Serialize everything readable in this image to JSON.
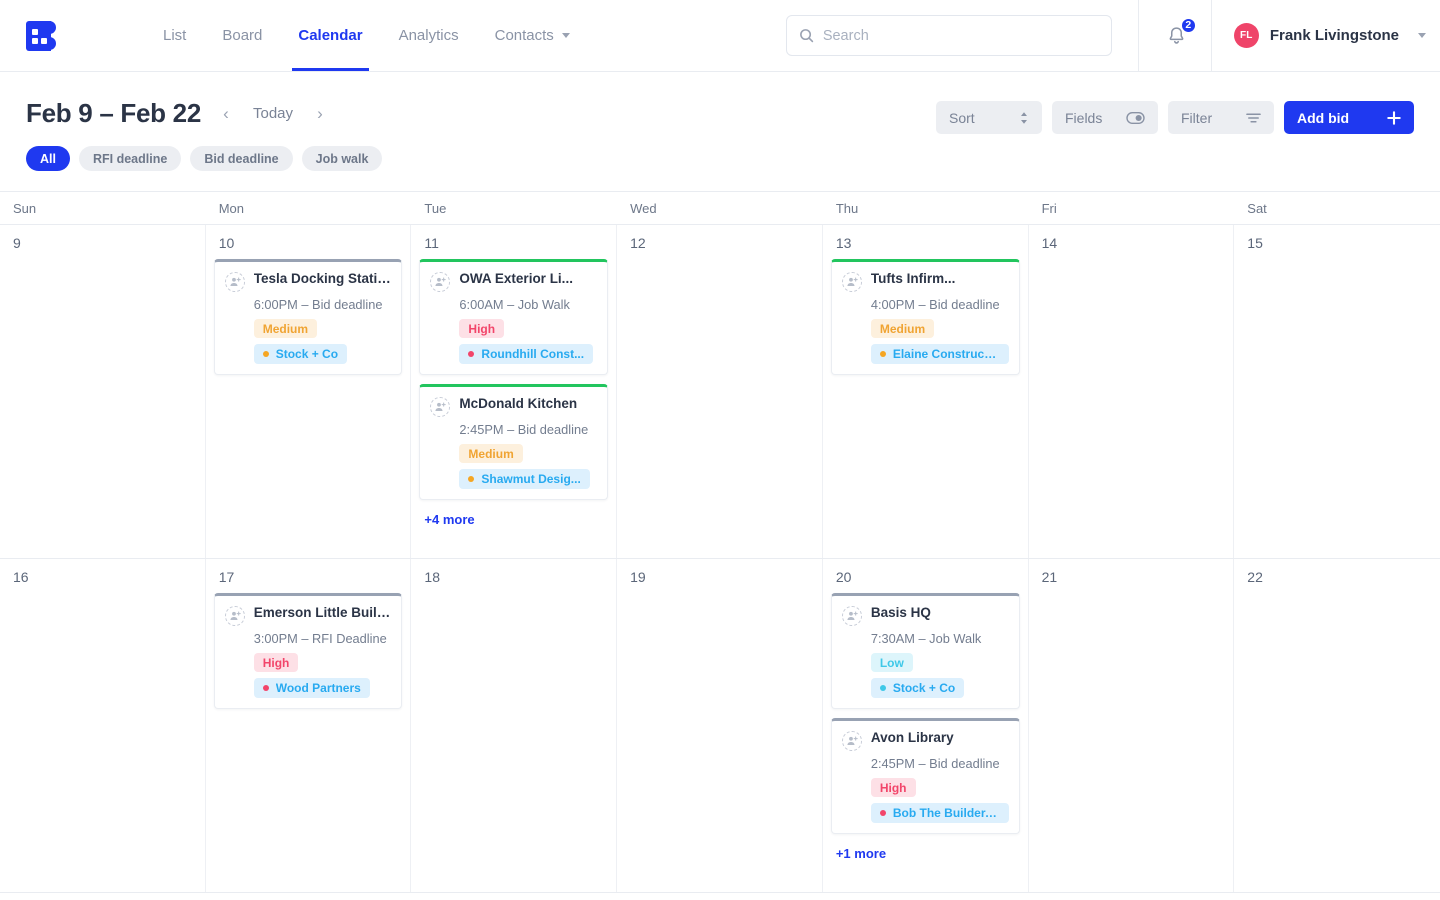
{
  "header": {
    "logo_icon": "logo-b-icon",
    "tabs": [
      {
        "label": "List",
        "active": false,
        "dropdown": false
      },
      {
        "label": "Board",
        "active": false,
        "dropdown": false
      },
      {
        "label": "Calendar",
        "active": true,
        "dropdown": false
      },
      {
        "label": "Analytics",
        "active": false,
        "dropdown": false
      },
      {
        "label": "Contacts",
        "active": false,
        "dropdown": true
      }
    ],
    "search": {
      "placeholder": "Search",
      "value": "",
      "icon": "search-icon"
    },
    "notifications": {
      "icon": "bell-icon",
      "count": "2"
    },
    "user": {
      "initials": "FL",
      "name": "Frank Livingstone",
      "caret": "chevron-down-icon"
    }
  },
  "toolbar": {
    "range_title": "Feb 9 – Feb 22",
    "prev_label": "‹",
    "today_label": "Today",
    "next_label": "›",
    "chips": [
      {
        "label": "All",
        "active": true
      },
      {
        "label": "RFI deadline",
        "active": false
      },
      {
        "label": "Bid deadline",
        "active": false
      },
      {
        "label": "Job walk",
        "active": false
      }
    ],
    "sort_label": "Sort",
    "fields_label": "Fields",
    "filter_label": "Filter",
    "add_label": "Add bid",
    "accent": "#1f39f0"
  },
  "calendar": {
    "weekdays": [
      "Sun",
      "Mon",
      "Tue",
      "Wed",
      "Thu",
      "Fri",
      "Sat"
    ],
    "weeks": [
      {
        "days": [
          {
            "num": "9",
            "events": [],
            "more": ""
          },
          {
            "num": "10",
            "more": "",
            "events": [
              {
                "title": "Tesla Docking Station",
                "time": "6:00PM – Bid deadline",
                "priority": "Medium",
                "priority_class": "medium",
                "company": "Stock + Co",
                "dot": "#f5a623",
                "accent": "gray",
                "avatar_icon": "person-add-icon"
              }
            ]
          },
          {
            "num": "11",
            "more": "+4 more",
            "events": [
              {
                "title": "OWA Exterior Li...",
                "time": "6:00AM – Job Walk",
                "priority": "High",
                "priority_class": "high",
                "company": "Roundhill Const...",
                "dot": "#f2456a",
                "accent": "green",
                "avatar_icon": "person-add-icon"
              },
              {
                "title": "McDonald Kitchen",
                "time": "2:45PM – Bid deadline",
                "priority": "Medium",
                "priority_class": "medium",
                "company": "Shawmut Desig...",
                "dot": "#f5a623",
                "accent": "green",
                "avatar_icon": "person-add-icon"
              }
            ]
          },
          {
            "num": "12",
            "events": [],
            "more": ""
          },
          {
            "num": "13",
            "more": "",
            "events": [
              {
                "title": "Tufts Infirm...",
                "time": "4:00PM – Bid deadline",
                "priority": "Medium",
                "priority_class": "medium",
                "company": "Elaine Construction",
                "dot": "#f5a623",
                "accent": "green",
                "avatar_icon": "person-add-icon"
              }
            ]
          },
          {
            "num": "14",
            "events": [],
            "more": ""
          },
          {
            "num": "15",
            "events": [],
            "more": ""
          }
        ]
      },
      {
        "days": [
          {
            "num": "16",
            "events": [],
            "more": ""
          },
          {
            "num": "17",
            "more": "",
            "events": [
              {
                "title": "Emerson Little Buildi...",
                "time": "3:00PM – RFI Deadline",
                "priority": "High",
                "priority_class": "high",
                "company": "Wood Partners",
                "dot": "#f2456a",
                "accent": "gray",
                "avatar_icon": "person-add-icon"
              }
            ]
          },
          {
            "num": "18",
            "events": [],
            "more": ""
          },
          {
            "num": "19",
            "events": [],
            "more": ""
          },
          {
            "num": "20",
            "more": "+1 more",
            "events": [
              {
                "title": "Basis HQ",
                "time": "7:30AM – Job Walk",
                "priority": "Low",
                "priority_class": "low",
                "company": "Stock + Co",
                "dot": "#3ec8e8",
                "accent": "gray",
                "avatar_icon": "person-add-icon"
              },
              {
                "title": "Avon Library",
                "time": "2:45PM – Bid deadline",
                "priority": "High",
                "priority_class": "high",
                "company": "Bob The Builder, Inc.",
                "dot": "#f2456a",
                "accent": "gray",
                "avatar_icon": "person-add-icon"
              }
            ]
          },
          {
            "num": "21",
            "events": [],
            "more": ""
          },
          {
            "num": "22",
            "events": [],
            "more": ""
          }
        ]
      }
    ]
  }
}
